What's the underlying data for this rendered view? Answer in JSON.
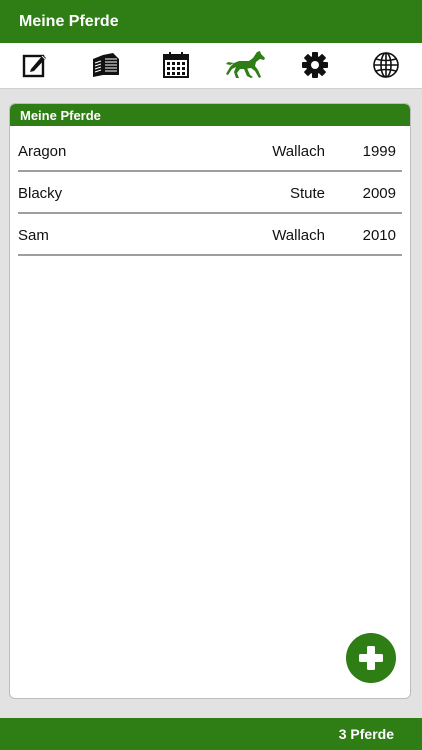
{
  "header": {
    "title": "Meine Pferde"
  },
  "toolbar": {
    "icons": [
      "edit-icon",
      "documents-icon",
      "calendar-icon",
      "horse-icon",
      "gear-icon",
      "globe-icon"
    ],
    "active": "horse-icon",
    "active_color": "#2e7d15"
  },
  "panel": {
    "title": "Meine Pferde",
    "horses": [
      {
        "name": "Aragon",
        "gender": "Wallach",
        "year": "1999"
      },
      {
        "name": "Blacky",
        "gender": "Stute",
        "year": "2009"
      },
      {
        "name": "Sam",
        "gender": "Wallach",
        "year": "2010"
      }
    ]
  },
  "fab": {
    "icon": "plus-icon"
  },
  "footer": {
    "count_label": "3 Pferde"
  },
  "colors": {
    "brand_green": "#2e7d15",
    "divider": "#9e9e9e"
  }
}
